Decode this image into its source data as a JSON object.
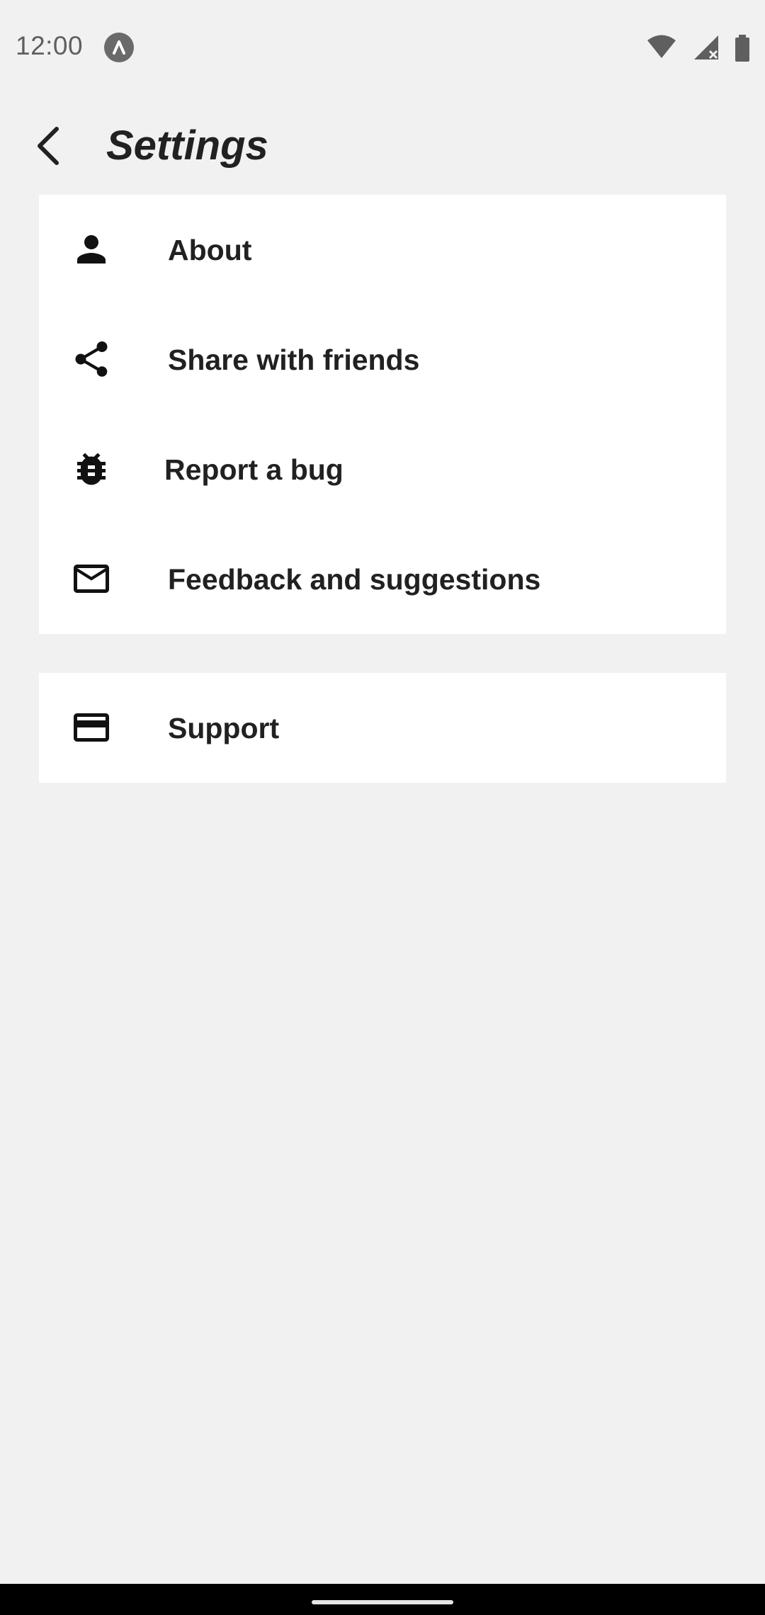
{
  "status_bar": {
    "time": "12:00",
    "app_icon": "notification-a-icon",
    "icons": [
      "wifi-icon",
      "signal-icon",
      "battery-icon"
    ]
  },
  "app_bar": {
    "back_icon": "back-arrow-icon",
    "title": "Settings"
  },
  "menu": {
    "items": [
      {
        "label": "About",
        "icon": "person-icon"
      },
      {
        "label": "Share with friends",
        "icon": "share-icon"
      },
      {
        "label": "Report a bug",
        "icon": "bug-icon"
      },
      {
        "label": "Feedback and suggestions",
        "icon": "mail-icon"
      }
    ]
  },
  "support": {
    "label": "Support",
    "icon": "credit-card-icon"
  },
  "colors": {
    "background": "#f1f1f1",
    "card": "#ffffff",
    "text": "#212121",
    "status_text": "#5f5f5f",
    "nav_bar": "#000000"
  }
}
